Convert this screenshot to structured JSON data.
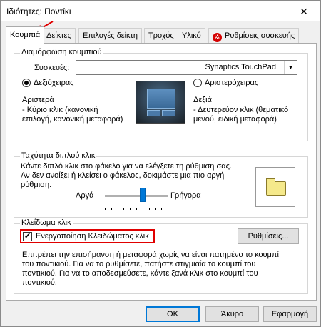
{
  "window": {
    "title": "Ιδιότητες: Ποντίκι",
    "close": "✕"
  },
  "tabs": [
    {
      "label": "Κουμπιά"
    },
    {
      "label": "Δείκτες"
    },
    {
      "label": "Επιλογές δείκτη"
    },
    {
      "label": "Τροχός"
    },
    {
      "label": "Υλικό"
    },
    {
      "label": "Ρυθμίσεις συσκευής"
    }
  ],
  "button_config": {
    "title": "Διαμόρφωση κουμπιού",
    "device_label": "Συσκευές:",
    "device_value": "Synaptics TouchPad",
    "right_handed": "Δεξιόχειρας",
    "left_handed": "Αριστερόχειρας",
    "left_title": "Αριστερά",
    "left_desc_1": " - Κύριο κλικ (κανονική",
    "left_desc_2": "επιλογή, κανονική μεταφορά)",
    "right_title": "Δεξιά",
    "right_desc_1": " - Δευτερεύον κλικ (θεματικό",
    "right_desc_2": "μενού, ειδική μεταφορά)"
  },
  "double_click": {
    "title": "Ταχύτητα διπλού κλικ",
    "line1": "Κάντε διπλό κλικ στο φάκελο για να ελέγξετε τη ρύθμιση σας.",
    "line2": "Αν δεν ανοίξει ή κλείσει ο φάκελος, δοκιμάστε μια πιο αργή",
    "line3": "ρύθμιση.",
    "slow": "Αργά",
    "fast": "Γρήγορα",
    "speed_fraction": 0.6
  },
  "click_lock": {
    "title": "Κλείδωμα κλικ",
    "checkbox_label": "Ενεργοποίηση Κλειδώματος κλικ",
    "checkbox_mark": "✔",
    "settings_button": "Ρυθμίσεις...",
    "desc_1": "Επιτρέπει την επισήμανση ή μεταφορά χωρίς να είναι πατημένο το κουμπί",
    "desc_2": "του ποντικιού.  Για να το ρυθμίσετε, πατήστε στιγμιαία το κουμπί του",
    "desc_3": "ποντικιού.  Για να το αποδεσμεύσετε, κάντε ξανά κλικ στο κουμπί του",
    "desc_4": "ποντικιού."
  },
  "dialog_buttons": {
    "ok": "OK",
    "cancel": "Άκυρο",
    "apply": "Εφαρμογή"
  },
  "colors": {
    "highlight": "#e00000",
    "accent": "#0078d7"
  }
}
